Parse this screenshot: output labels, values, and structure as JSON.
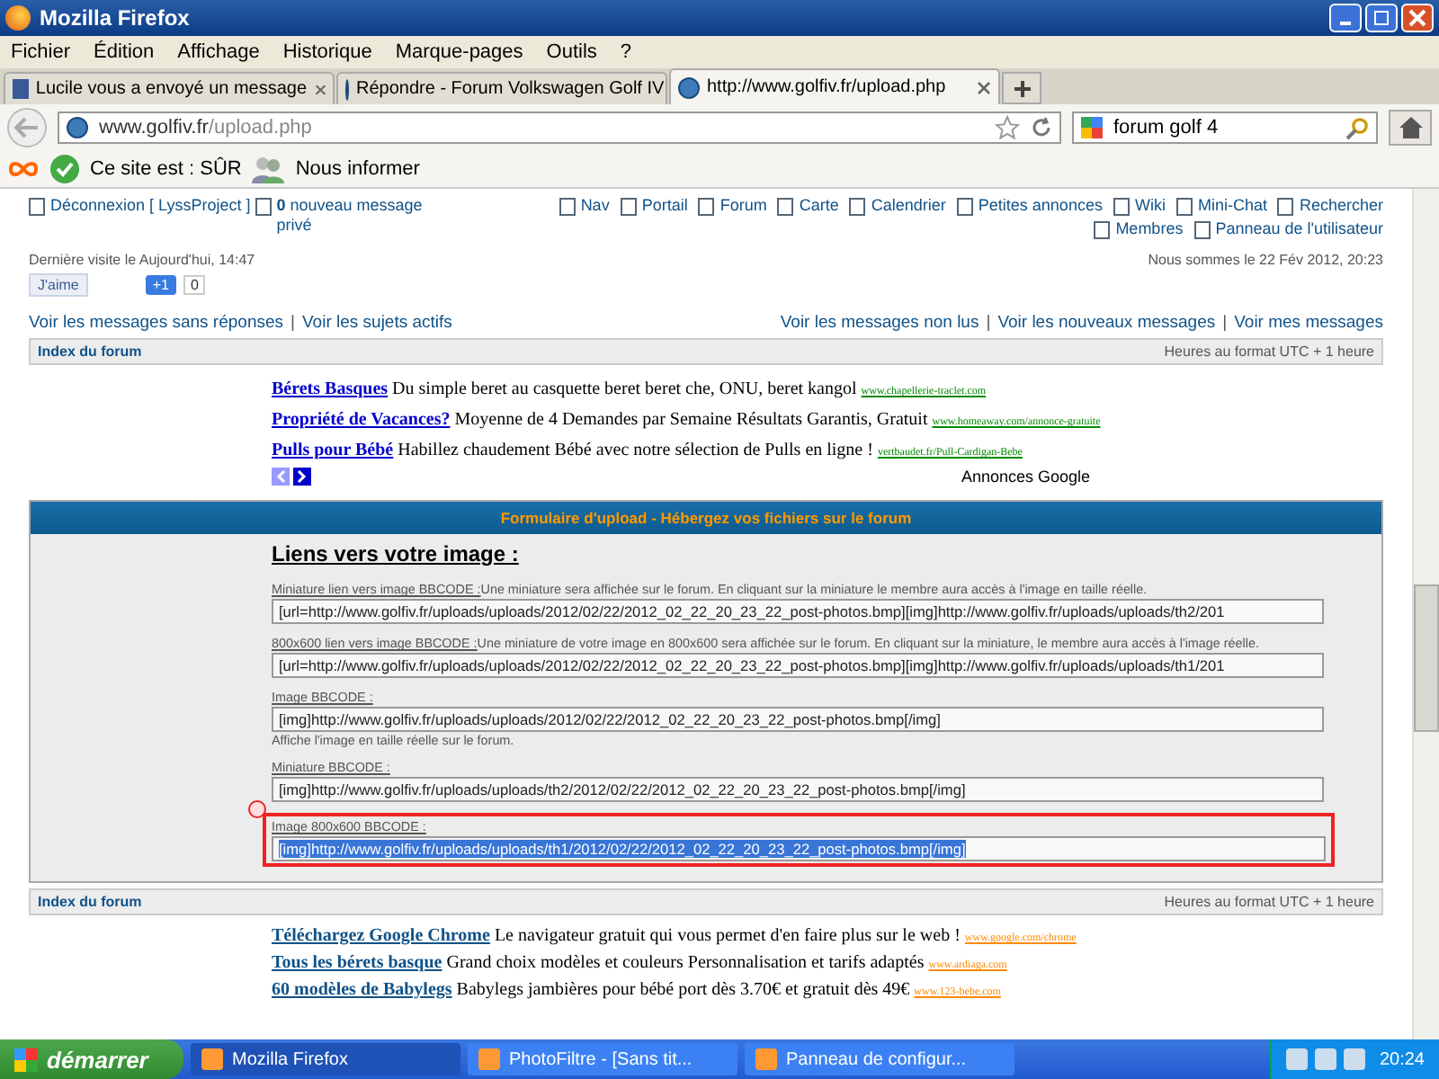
{
  "window": {
    "title": "Mozilla Firefox"
  },
  "menu": [
    "Fichier",
    "Édition",
    "Affichage",
    "Historique",
    "Marque-pages",
    "Outils",
    "?"
  ],
  "tabs": [
    {
      "label": "Lucile vous a envoyé un message",
      "selected": false,
      "kind": "facebook"
    },
    {
      "label": "Répondre - Forum Volkswagen Golf IV",
      "selected": false,
      "kind": "site"
    },
    {
      "label": "http://www.golfiv.fr/upload.php",
      "selected": true,
      "kind": "site"
    }
  ],
  "address": {
    "domain": "www.golfiv.fr",
    "path": "/upload.php"
  },
  "search": {
    "value": "forum golf 4"
  },
  "addon_bar": {
    "status": "Ce site est : SÛR",
    "inform": "Nous informer"
  },
  "forum_header": {
    "logout": "Déconnexion [ LyssProject ]",
    "pm_count": "0",
    "pm_text": "nouveau message privé",
    "nav": [
      {
        "label": "Nav"
      },
      {
        "label": "Portail"
      },
      {
        "label": "Forum"
      },
      {
        "label": "Carte"
      },
      {
        "label": "Calendrier"
      },
      {
        "label": "Petites annonces"
      },
      {
        "label": "Wiki"
      },
      {
        "label": "Mini-Chat"
      },
      {
        "label": "Rechercher"
      },
      {
        "label": "Membres"
      },
      {
        "label": "Panneau de l'utilisateur"
      }
    ],
    "last_visit": "Dernière visite le Aujourd'hui, 14:47",
    "current_date": "Nous sommes le 22 Fév 2012, 20:23",
    "like": "J'aime",
    "plus_one": "+1",
    "plus_count": "0",
    "separator": "|",
    "left_links": [
      "Voir les messages sans réponses",
      "Voir les sujets actifs"
    ],
    "right_links": [
      "Voir les messages non lus",
      "Voir les nouveaux messages",
      "Voir mes messages"
    ]
  },
  "breadcrumb_top": {
    "index": "Index du forum",
    "timezone": "Heures au format UTC + 1 heure"
  },
  "ads_top": [
    {
      "title": "Bérets Basques",
      "text": "Du simple beret au casquette beret beret che, ONU, beret kangol",
      "url": "www.chapellerie-traclet.com"
    },
    {
      "title": "Propriété de Vacances?",
      "text": "Moyenne de 4 Demandes par Semaine Résultats Garantis, Gratuit",
      "url": "www.homeaway.com/annonce-gratuite"
    },
    {
      "title": "Pulls pour Bébé",
      "text": "Habillez chaudement Bébé avec notre sélection de Pulls en ligne !",
      "url": "vertbaudet.fr/Pull-Cardigan-Bebe"
    }
  ],
  "ads_label": "Annonces Google",
  "upload": {
    "header": "Formulaire d'upload - Hébergez vos fichiers sur le forum",
    "heading": "Liens vers votre image :",
    "fields": [
      {
        "label": "Miniature lien vers image BBCODE :",
        "note": "Une miniature sera affichée sur le forum. En cliquant sur la miniature le membre aura accès à l'image en taille réelle.",
        "note_below": false,
        "value": "[url=http://www.golfiv.fr/uploads/uploads/2012/02/22/2012_02_22_20_23_22_post-photos.bmp][img]http://www.golfiv.fr/uploads/uploads/th2/201",
        "selected": false
      },
      {
        "label": "800x600 lien vers image BBCODE :",
        "note": "Une miniature de votre image en 800x600 sera affichée sur le forum. En cliquant sur la miniature, le membre aura accès à l'image réelle.",
        "note_below": false,
        "value": "[url=http://www.golfiv.fr/uploads/uploads/2012/02/22/2012_02_22_20_23_22_post-photos.bmp][img]http://www.golfiv.fr/uploads/uploads/th1/201",
        "selected": false
      },
      {
        "label": "Image BBCODE :",
        "note": "Affiche l'image en taille réelle sur le forum.",
        "note_below": true,
        "value": "[img]http://www.golfiv.fr/uploads/uploads/2012/02/22/2012_02_22_20_23_22_post-photos.bmp[/img]",
        "selected": false
      },
      {
        "label": "Miniature BBCODE :",
        "value": "[img]http://www.golfiv.fr/uploads/uploads/th2/2012/02/22/2012_02_22_20_23_22_post-photos.bmp[/img]",
        "selected": false
      },
      {
        "label": "Image 800x600 BBCODE :",
        "value": "[img]http://www.golfiv.fr/uploads/uploads/th1/2012/02/22/2012_02_22_20_23_22_post-photos.bmp[/img]",
        "selected": true
      }
    ]
  },
  "breadcrumb_bottom": {
    "index": "Index du forum",
    "timezone": "Heures au format UTC + 1 heure"
  },
  "ads_bottom": [
    {
      "title": "Téléchargez Google Chrome",
      "text": "Le navigateur gratuit qui vous permet d'en faire plus sur le web !",
      "url": "www.google.com/chrome"
    },
    {
      "title": "Tous les bérets basque",
      "text": "Grand choix modèles et couleurs Personnalisation et tarifs adaptés",
      "url": "www.ardiaga.com"
    },
    {
      "title": "60 modèles de Babylegs",
      "text": "Babylegs jambières pour bébé port dès 3.70€ et gratuit dès 49€",
      "url": "www.123-bebe.com"
    }
  ],
  "taskbar": {
    "start": "démarrer",
    "tasks": [
      {
        "label": "Mozilla Firefox",
        "selected": true
      },
      {
        "label": "PhotoFiltre - [Sans tit...",
        "selected": false
      },
      {
        "label": "Panneau de configur...",
        "selected": false
      }
    ],
    "clock": "20:24"
  }
}
